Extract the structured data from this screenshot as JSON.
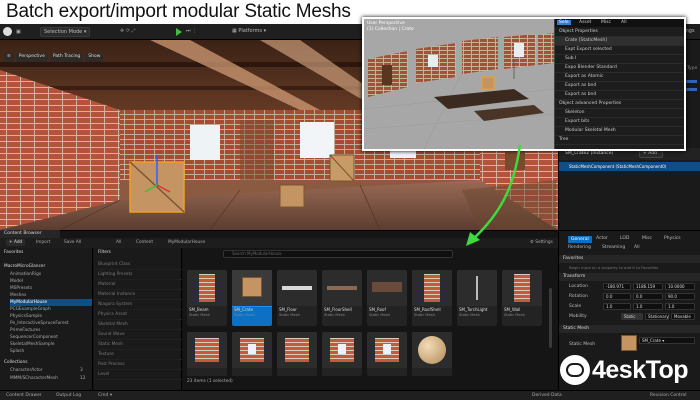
{
  "banner": {
    "title": "Batch export/import modular Static Meshs"
  },
  "topbar": {
    "selection_mode": "Selection Mode",
    "platforms": "Platforms",
    "settings": "Settings"
  },
  "viewport": {
    "perspective": "Perspective",
    "path_tracing": "Path Tracing",
    "show": "Show"
  },
  "popup": {
    "view_title": "User Perspective",
    "view_subtitle": "(1) Collection | Crate",
    "menu_tabs": [
      "Sele",
      "Asset",
      "Misc",
      "All"
    ],
    "menu_items": [
      "Object Properties",
      "Crate   [StaticMesh]",
      "Expt   Export selected",
      "Sub I",
      "Expo   Blender Standard",
      "Export as Atomic",
      "Export as bnd",
      "Export as bnd",
      "Object advanced Properties",
      "Skeleton",
      "Export bits",
      "Modular Skeletal Mesh",
      "Tree"
    ]
  },
  "outliner": {
    "type_header": "Type",
    "add_label": "+ Add",
    "selected_item": "SM_Crate2 (Instance)",
    "component": "StaticMeshComponent (StaticMeshComponent0)"
  },
  "details": {
    "tabs": [
      "General",
      "Actor",
      "LOD",
      "Misc",
      "Physics",
      "Rendering",
      "Streaming",
      "All"
    ],
    "favorites": "Favorites",
    "hint": "Begin more on a property to add it to Favorites",
    "transform": "Transform",
    "location_label": "Location",
    "location": [
      "-180.971",
      "1186.159",
      "10.0000"
    ],
    "rotation_label": "Rotation",
    "rotation": [
      "0.0",
      "0.0",
      "90.0"
    ],
    "scale_label": "Scale",
    "scale": [
      "1.0",
      "1.0",
      "1.0"
    ],
    "mobility_label": "Mobility",
    "mobility": [
      "Static",
      "Stationary",
      "Movable"
    ],
    "static_mesh_section": "Static Mesh",
    "static_mesh_label": "Static Mesh",
    "static_mesh_value": "SM_Crate"
  },
  "content_browser": {
    "tab": "Content Browser",
    "add": "+ Add",
    "import": "Import",
    "save_all": "Save All",
    "breadcrumb": [
      "All",
      "Content",
      "MyModularHouse"
    ],
    "settings": "Settings",
    "search_placeholder": "Search MyModularHouse",
    "favorites": "Favorites",
    "tree_root": "MacroMicroGlancer",
    "tree": [
      "AnimationRigs",
      "Model",
      "MSPresets",
      "Meshes",
      "MyModularHouse",
      "PCGExampleGraph",
      "PhysicsSample",
      "Pe_InteractiveSpruceForest",
      "PrimeFactures",
      "SequencerComponent",
      "SkeletalMeshSample",
      "Splash"
    ],
    "collections": "Collections",
    "collection_items": [
      {
        "name": "CharacterActor",
        "count": "3"
      },
      {
        "name": "MMM/SCharacterMesh",
        "count": "12"
      }
    ],
    "filters": "Filters",
    "filter_items": [
      "Blueprint Class",
      "Lighting Presets",
      "Material",
      "Material Instance",
      "Niagara System",
      "Physics Asset",
      "Skeletal Mesh",
      "Sound Wave",
      "Static Mesh",
      "Texture",
      "Post Process",
      "Level"
    ],
    "assets_row1": [
      {
        "name": "SM_Beam",
        "type": "Static Mesh"
      },
      {
        "name": "SM_Crate",
        "type": "Static Mesh"
      },
      {
        "name": "SM_Floor",
        "type": "Static Mesh"
      },
      {
        "name": "SM_FloorShell",
        "type": "Static Mesh"
      },
      {
        "name": "SM_Roof",
        "type": "Static Mesh"
      },
      {
        "name": "SM_RoofShell",
        "type": "Static Mesh"
      },
      {
        "name": "SM_TorchLight",
        "type": "Static Mesh"
      },
      {
        "name": "SM_Wall",
        "type": "Static Mesh"
      }
    ],
    "item_count": "23 items (1 selected)"
  },
  "status": {
    "content_drawer": "Content Drawer",
    "output_log": "Output Log",
    "cmd": "Cmd",
    "derived_data": "Derived Data",
    "revision_control": "Revision Control"
  },
  "watermark": {
    "text": "4eskTop"
  },
  "colors": {
    "accent": "#0c70c4",
    "selection": "#f0a020",
    "arrow": "#3ddb3d"
  }
}
